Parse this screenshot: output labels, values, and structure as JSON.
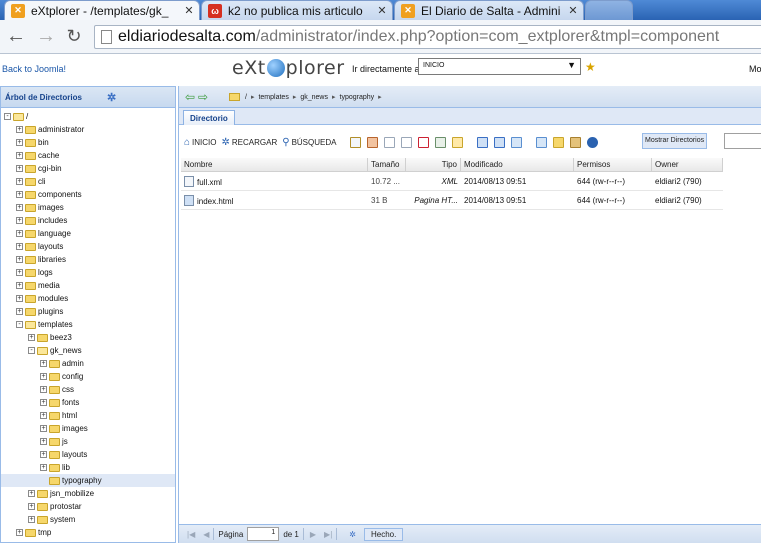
{
  "browser": {
    "tabs": [
      {
        "title": "eXtplorer - /templates/gk_",
        "icon": "extplorer-icon",
        "active": true
      },
      {
        "title": "k2 no publica mis articulo",
        "icon": "site-icon",
        "active": false
      },
      {
        "title": "El Diario de Salta - Admini",
        "icon": "extplorer-icon",
        "active": false
      }
    ],
    "close_glyph": "✕",
    "url_host": "eldiariodesalta.com",
    "url_path": "/administrator/index.php?option=com_extplorer&tmpl=component"
  },
  "app": {
    "back_link": "Back to Joomla!",
    "logo_left": "eXt",
    "logo_right": "plorer",
    "goto_label": "Ir directamente a:",
    "goto_value": "INICIO",
    "mo_text": "Mo"
  },
  "tree": {
    "title": "Árbol de Directorios",
    "items": [
      {
        "label": "/",
        "level": 0,
        "expander": "-"
      },
      {
        "label": "administrator",
        "level": 1,
        "expander": "+"
      },
      {
        "label": "bin",
        "level": 1,
        "expander": "+"
      },
      {
        "label": "cache",
        "level": 1,
        "expander": "+"
      },
      {
        "label": "cgi-bin",
        "level": 1,
        "expander": "+"
      },
      {
        "label": "cli",
        "level": 1,
        "expander": "+"
      },
      {
        "label": "components",
        "level": 1,
        "expander": "+"
      },
      {
        "label": "images",
        "level": 1,
        "expander": "+"
      },
      {
        "label": "includes",
        "level": 1,
        "expander": "+"
      },
      {
        "label": "language",
        "level": 1,
        "expander": "+"
      },
      {
        "label": "layouts",
        "level": 1,
        "expander": "+"
      },
      {
        "label": "libraries",
        "level": 1,
        "expander": "+"
      },
      {
        "label": "logs",
        "level": 1,
        "expander": "+"
      },
      {
        "label": "media",
        "level": 1,
        "expander": "+"
      },
      {
        "label": "modules",
        "level": 1,
        "expander": "+"
      },
      {
        "label": "plugins",
        "level": 1,
        "expander": "+"
      },
      {
        "label": "templates",
        "level": 1,
        "expander": "-"
      },
      {
        "label": "beez3",
        "level": 2,
        "expander": "+"
      },
      {
        "label": "gk_news",
        "level": 2,
        "expander": "-"
      },
      {
        "label": "admin",
        "level": 3,
        "expander": "+"
      },
      {
        "label": "config",
        "level": 3,
        "expander": "+"
      },
      {
        "label": "css",
        "level": 3,
        "expander": "+"
      },
      {
        "label": "fonts",
        "level": 3,
        "expander": "+"
      },
      {
        "label": "html",
        "level": 3,
        "expander": "+"
      },
      {
        "label": "images",
        "level": 3,
        "expander": "+"
      },
      {
        "label": "js",
        "level": 3,
        "expander": "+"
      },
      {
        "label": "layouts",
        "level": 3,
        "expander": "+"
      },
      {
        "label": "lib",
        "level": 3,
        "expander": "+"
      },
      {
        "label": "typography",
        "level": 3,
        "expander": "",
        "selected": true
      },
      {
        "label": "jsn_mobilize",
        "level": 2,
        "expander": "+"
      },
      {
        "label": "protostar",
        "level": 2,
        "expander": "+"
      },
      {
        "label": "system",
        "level": 2,
        "expander": "+"
      },
      {
        "label": "tmp",
        "level": 1,
        "expander": "+"
      }
    ]
  },
  "path": {
    "root": "/",
    "parts": [
      "templates",
      "gk_news",
      "typography"
    ]
  },
  "dir_tab": "Directorio",
  "actions": {
    "home": "INICIO",
    "reload": "RECARGAR",
    "search": "BÚSQUEDA",
    "show_dirs": "Mostrar Directorios"
  },
  "grid": {
    "columns": [
      "Nombre",
      "Tamaño",
      "Tipo",
      "Modificado",
      "Permisos",
      "Owner"
    ],
    "rows": [
      {
        "name": "full.xml",
        "size": "10.72 ...",
        "type": "XML",
        "modified": "2014/08/13 09:51",
        "perms": "644 (rw-r--r--)",
        "owner": "eldiari2 (790)"
      },
      {
        "name": "index.html",
        "size": "31 B",
        "type": "Pagina HT...",
        "modified": "2014/08/13 09:51",
        "perms": "644 (rw-r--r--)",
        "owner": "eldiari2 (790)"
      }
    ]
  },
  "pager": {
    "page_label": "Página",
    "page_value": "1",
    "of_label": "de 1",
    "status": "Hecho."
  }
}
